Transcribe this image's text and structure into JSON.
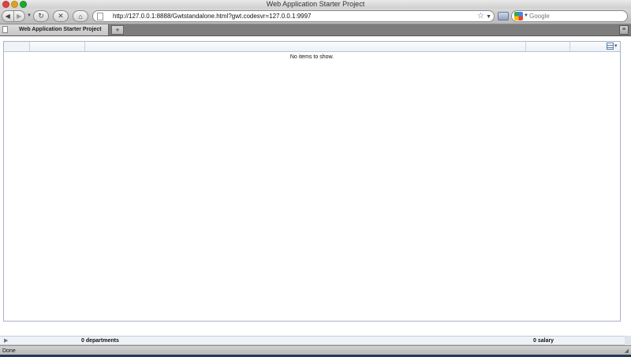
{
  "window": {
    "title": "Web Application Starter Project"
  },
  "toolbar": {
    "url": "http://127.0.0.1:8888/Gwtstandalone.html?gwt.codesvr=127.0.0.1:9997",
    "search_placeholder": "Google",
    "back_glyph": "◀",
    "forward_glyph": "▶",
    "reload_glyph": "↻",
    "stop_glyph": "✕",
    "home_glyph": "⌂",
    "bookmark_glyph": "☆",
    "dropdown_glyph": "▼"
  },
  "tabs": [
    {
      "label": "Web Application Starter Project",
      "active": true
    }
  ],
  "tabbar": {
    "new_tab_glyph": "+",
    "menu_glyph": "≡"
  },
  "grid": {
    "empty_message": "No items to show.",
    "filter_glyph": "▾"
  },
  "summary": {
    "expander_glyph": "▶",
    "departments": "0 departments",
    "salary": "0 salary"
  },
  "status": {
    "text": "Done",
    "grip_glyph": "◢"
  },
  "colors": {
    "accent": "#3a6fd4",
    "grid_border": "#a7b4c7",
    "summary_bg": "#eef1f6"
  }
}
